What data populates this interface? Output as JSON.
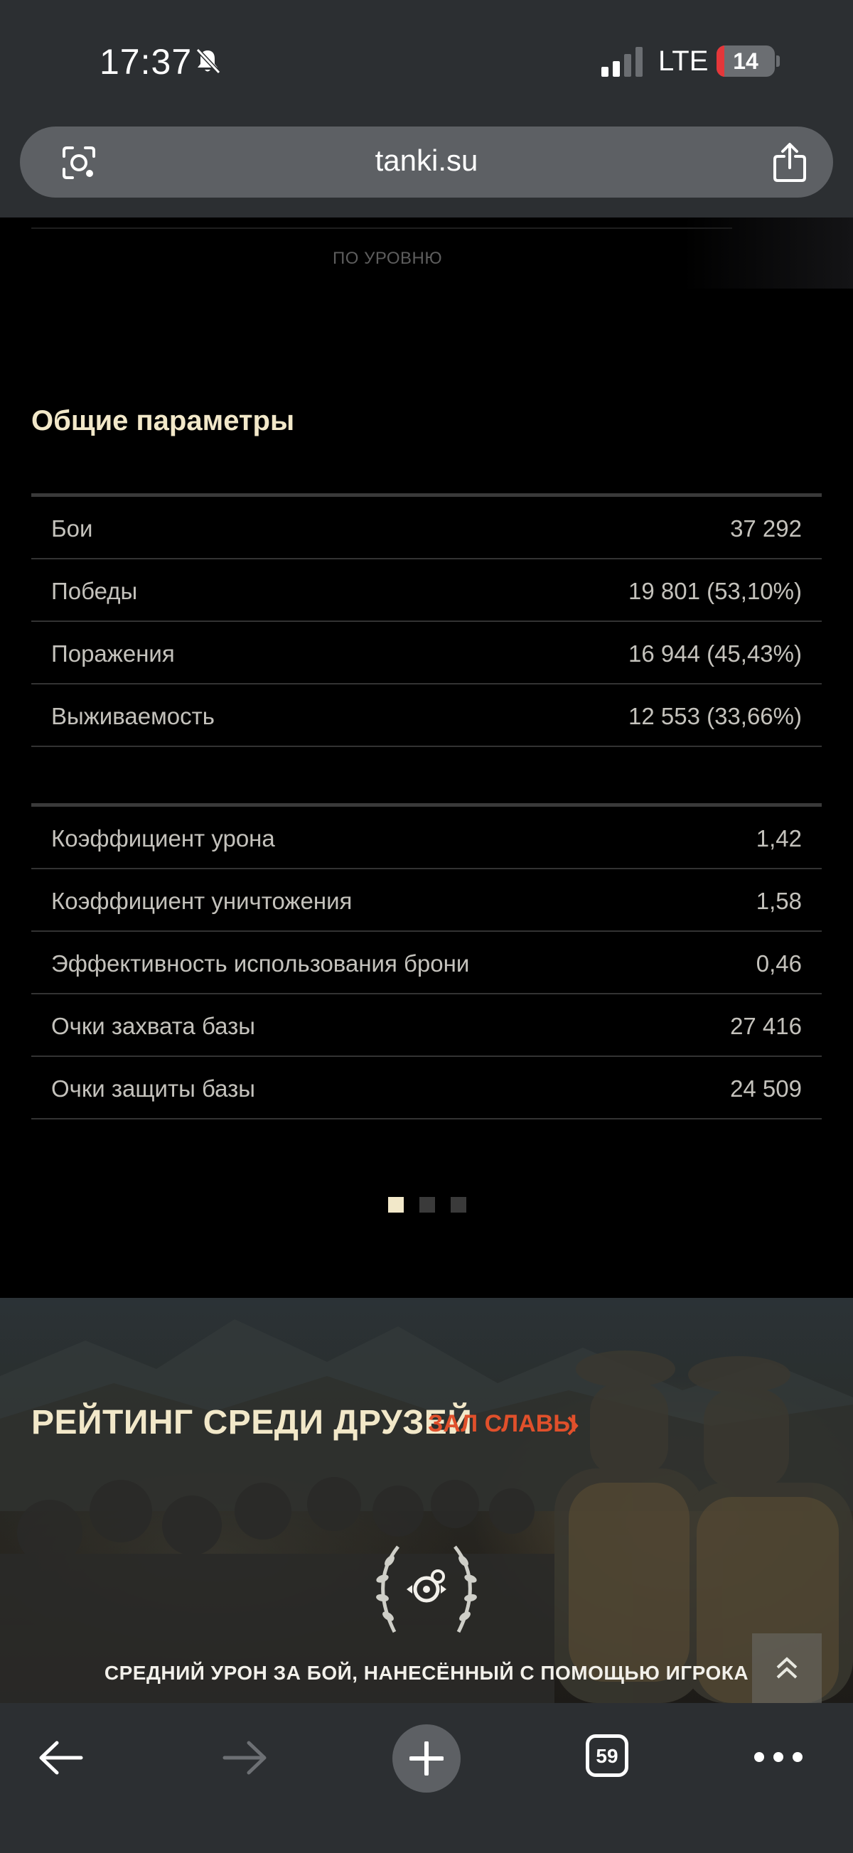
{
  "status_bar": {
    "time": "17:37",
    "network": "LTE",
    "battery": "14",
    "battery_level": 0.14
  },
  "browser": {
    "url": "tanki.su",
    "tabs_count": "59"
  },
  "page": {
    "level_label": "ПО УРОВНЮ",
    "section_title": "Общие параметры",
    "stats_group_1": [
      {
        "label": "Бои",
        "value": "37 292"
      },
      {
        "label": "Победы",
        "value": "19 801 (53,10%)"
      },
      {
        "label": "Поражения",
        "value": "16 944 (45,43%)"
      },
      {
        "label": "Выживаемость",
        "value": "12 553 (33,66%)"
      }
    ],
    "stats_group_2": [
      {
        "label": "Коэффициент урона",
        "value": "1,42"
      },
      {
        "label": "Коэффициент уничтожения",
        "value": "1,58"
      },
      {
        "label": "Эффективность использования брони",
        "value": "0,46"
      },
      {
        "label": "Очки захвата базы",
        "value": "27 416"
      },
      {
        "label": "Очки защиты базы",
        "value": "24 509"
      }
    ],
    "pagination": {
      "total": 3,
      "active": 1,
      "active_color": "#f2e8c9",
      "inactive_color": "#3a3a3a"
    }
  },
  "banner": {
    "title": "РЕЙТИНГ СРЕДИ ДРУЗЕЙ",
    "link": "ЗАЛ СЛАВЫ",
    "caption": "СРЕДНИЙ УРОН ЗА БОЙ, НАНЕСЁННЫЙ С ПОМОЩЬЮ ИГРОКА"
  },
  "colors": {
    "accent": "#e0502b",
    "title": "#f2e8c9",
    "text": "#c4c2bc",
    "chrome": "#2c2f32"
  }
}
